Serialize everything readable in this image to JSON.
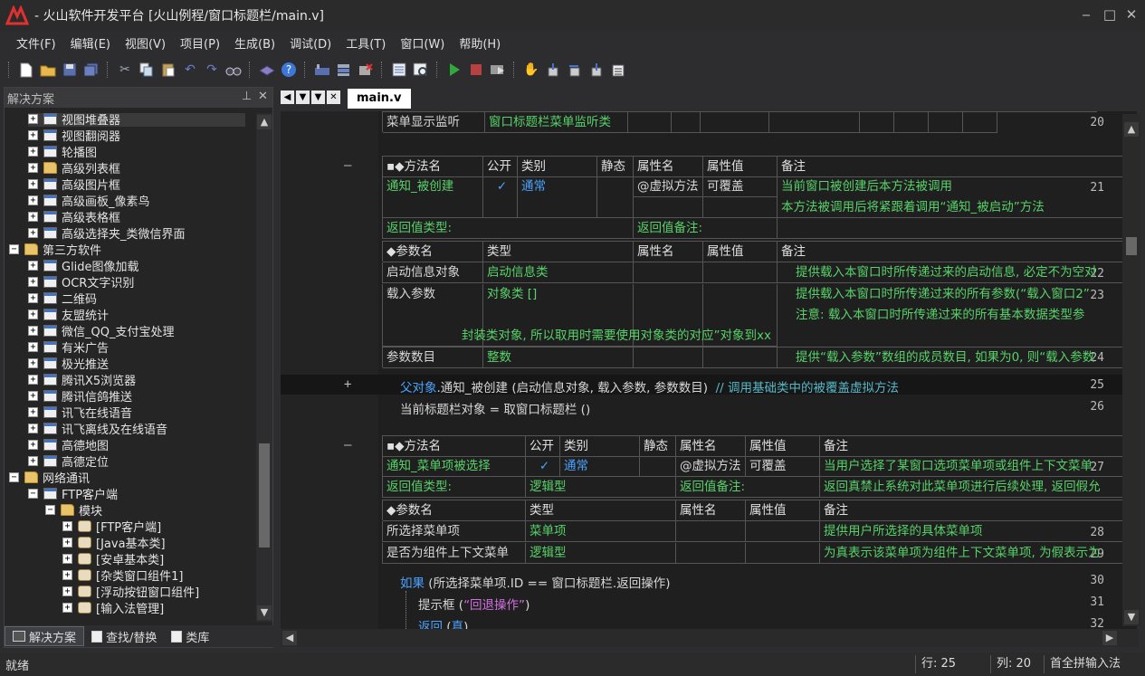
{
  "window": {
    "title": "- 火山软件开发平台 [火山例程/窗口标题栏/main.v]",
    "min": "‒",
    "max": "□",
    "close": "✕"
  },
  "menu": [
    "文件(F)",
    "编辑(E)",
    "视图(V)",
    "项目(P)",
    "生成(B)",
    "调试(D)",
    "工具(T)",
    "窗口(W)",
    "帮助(H)"
  ],
  "left_panel": {
    "title": "解决方案",
    "pin": "⊥",
    "close": "✕",
    "tree": [
      {
        "label": "视图堆叠器",
        "level": 1,
        "icon": "grid",
        "exp": "+",
        "sel": true
      },
      {
        "label": "视图翻阅器",
        "level": 1,
        "icon": "grid",
        "exp": "+"
      },
      {
        "label": "轮播图",
        "level": 1,
        "icon": "grid",
        "exp": "+"
      },
      {
        "label": "高级列表框",
        "level": 1,
        "icon": "folder",
        "exp": "+"
      },
      {
        "label": "高级图片框",
        "level": 1,
        "icon": "grid",
        "exp": "+"
      },
      {
        "label": "高级画板_像素鸟",
        "level": 1,
        "icon": "grid",
        "exp": "+"
      },
      {
        "label": "高级表格框",
        "level": 1,
        "icon": "grid",
        "exp": "+"
      },
      {
        "label": "高级选择夹_类微信界面",
        "level": 1,
        "icon": "grid",
        "exp": "+"
      },
      {
        "label": "第三方软件",
        "level": 0,
        "icon": "folder",
        "exp": "−"
      },
      {
        "label": "Glide图像加载",
        "level": 1,
        "icon": "grid",
        "exp": "+"
      },
      {
        "label": "OCR文字识别",
        "level": 1,
        "icon": "grid",
        "exp": "+"
      },
      {
        "label": "二维码",
        "level": 1,
        "icon": "grid",
        "exp": "+"
      },
      {
        "label": "友盟统计",
        "level": 1,
        "icon": "grid",
        "exp": "+"
      },
      {
        "label": "微信_QQ_支付宝处理",
        "level": 1,
        "icon": "grid",
        "exp": "+"
      },
      {
        "label": "有米广告",
        "level": 1,
        "icon": "grid",
        "exp": "+"
      },
      {
        "label": "极光推送",
        "level": 1,
        "icon": "grid",
        "exp": "+"
      },
      {
        "label": "腾讯X5浏览器",
        "level": 1,
        "icon": "grid",
        "exp": "+"
      },
      {
        "label": "腾讯信鸽推送",
        "level": 1,
        "icon": "grid",
        "exp": "+"
      },
      {
        "label": "讯飞在线语音",
        "level": 1,
        "icon": "grid",
        "exp": "+"
      },
      {
        "label": "讯飞离线及在线语音",
        "level": 1,
        "icon": "grid",
        "exp": "+"
      },
      {
        "label": "高德地图",
        "level": 1,
        "icon": "grid",
        "exp": "+"
      },
      {
        "label": "高德定位",
        "level": 1,
        "icon": "grid",
        "exp": "+"
      },
      {
        "label": "网络通讯",
        "level": 0,
        "icon": "folder",
        "exp": "−"
      },
      {
        "label": "FTP客户端",
        "level": 1,
        "icon": "grid",
        "exp": "−"
      },
      {
        "label": "模块",
        "level": 2,
        "icon": "folder",
        "exp": "−"
      },
      {
        "label": "[FTP客户端]",
        "level": 3,
        "icon": "mod",
        "exp": "+"
      },
      {
        "label": "[Java基本类]",
        "level": 3,
        "icon": "mod",
        "exp": "+"
      },
      {
        "label": "[安卓基本类]",
        "level": 3,
        "icon": "mod",
        "exp": "+"
      },
      {
        "label": "[杂类窗口组件1]",
        "level": 3,
        "icon": "mod",
        "exp": "+"
      },
      {
        "label": "[浮动按钮窗口组件]",
        "level": 3,
        "icon": "mod",
        "exp": "+"
      },
      {
        "label": "[输入法管理]",
        "level": 3,
        "icon": "mod",
        "exp": "+"
      }
    ],
    "tabs": [
      "解决方案",
      "查找/替换",
      "类库"
    ]
  },
  "doc_tab": "main.v",
  "code": {
    "line20": {
      "n": "20",
      "name": "菜单显示监听",
      "type": "窗口标题栏菜单监听类"
    },
    "m1_hdr": [
      "▪◆方法名",
      "公开",
      "类别",
      "静态",
      "属性名",
      "属性值",
      "备注"
    ],
    "m1": {
      "n": "21",
      "name": "通知_被创建",
      "public": "✓",
      "cat": "通常",
      "attr": "@虚拟方法",
      "val": "可覆盖",
      "note1": "当前窗口被创建后本方法被调用",
      "note2": "本方法被调用后将紧跟着调用“通知_被启动”方法"
    },
    "ret1": {
      "label": "返回值类型:",
      "note_label": "返回值备注:"
    },
    "p1_hdr": [
      "◆参数名",
      "类型",
      "属性名",
      "属性值",
      "备注"
    ],
    "p1": [
      {
        "n": "22",
        "name": "启动信息对象",
        "type": "启动信息类",
        "note": "提供载入本窗口时所传递过来的启动信息, 必定不为空对"
      },
      {
        "n": "23",
        "name": "载入参数",
        "type": "对象类 []",
        "note": "提供载入本窗口时所传递过来的所有参数(“载入窗口2”",
        "note2": "注意: 载入本窗口时所传递过来的所有基本数据类型参",
        "note3": "封装类对象, 所以取用时需要使用对象类的对应”对象到xx"
      },
      {
        "n": "24",
        "name": "参数数目",
        "type": "整数",
        "note": "提供“载入参数”数组的成员数目, 如果为0, 则“载入参数"
      }
    ],
    "line25": {
      "n": "25",
      "obj": "父对象",
      "rest": ".通知_被创建 (启动信息对象,  载入参数,  参数数目)",
      "cmt": "// 调用基础类中的被覆盖虚拟方法"
    },
    "line26": {
      "n": "26",
      "text": "当前标题栏对象 = 取窗口标题栏 ()"
    },
    "m2": {
      "n": "27",
      "name": "通知_菜单项被选择",
      "public": "✓",
      "cat": "通常",
      "attr": "@虚拟方法",
      "val": "可覆盖",
      "note": "当用户选择了某窗口选项菜单项或组件上下文菜单",
      "ret_type": "逻辑型",
      "ret_note": "返回真禁止系统对此菜单项进行后续处理, 返回假允"
    },
    "p2": [
      {
        "n": "28",
        "name": "所选择菜单项",
        "type": "菜单项",
        "note": "提供用户所选择的具体菜单项"
      },
      {
        "n": "29",
        "name": "是否为组件上下文菜单",
        "type": "逻辑型",
        "note": "为真表示该菜单项为组件上下文菜单项, 为假表示为"
      }
    ],
    "line30": {
      "n": "30",
      "kw": "如果",
      "rest": " (所选择菜单项.ID == 窗口标题栏.返回操作)"
    },
    "line31": {
      "n": "31",
      "fn": "提示框 (",
      "str": "“回退操作”",
      "end": ")"
    },
    "line32": {
      "n": "32",
      "kw": "返回",
      "rest": " (",
      "kw2": "真",
      "end": ")"
    }
  },
  "status": {
    "ready": "就绪",
    "row": "行: 25",
    "col": "列: 20",
    "ime": "首全拼输入法"
  }
}
